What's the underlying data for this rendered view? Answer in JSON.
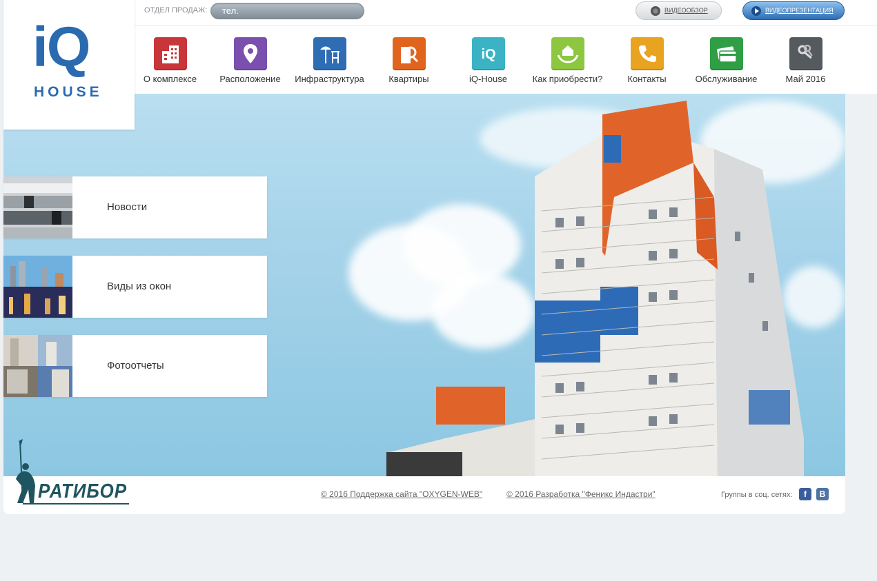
{
  "header": {
    "sales_label": "ОТДЕЛ ПРОДАЖ:",
    "phone_label": "тел.",
    "video_review": "ВИДЕООБЗОР",
    "video_presentation": "ВИДЕОПРЕЗЕНТАЦИЯ"
  },
  "logo": {
    "iq": "iQ",
    "house": "HOUSE"
  },
  "nav": [
    {
      "label": "О комплексе",
      "color": "#c8363a",
      "icon": "building-icon"
    },
    {
      "label": "Расположение",
      "color": "#7b4fae",
      "icon": "map-pin-icon"
    },
    {
      "label": "Инфраструктура",
      "color": "#2e6db4",
      "icon": "playground-icon"
    },
    {
      "label": "Квартиры",
      "color": "#e0641e",
      "icon": "search-building-icon"
    },
    {
      "label": "iQ-House",
      "color": "#3bb3c5",
      "icon": "iq-logo-icon"
    },
    {
      "label": "Как приобрести?",
      "color": "#8dc63f",
      "icon": "house-hands-icon"
    },
    {
      "label": "Контакты",
      "color": "#e8a321",
      "icon": "phone-icon"
    },
    {
      "label": "Обслуживание",
      "color": "#2f9e45",
      "icon": "card-icon"
    },
    {
      "label": "Май 2016",
      "color": "#555a5f",
      "icon": "keys-icon"
    }
  ],
  "cards": [
    {
      "label": "Новости",
      "thumb": "pipes-thumbnail"
    },
    {
      "label": "Виды из окон",
      "thumb": "city-view-thumbnail"
    },
    {
      "label": "Фотоотчеты",
      "thumb": "construction-photo-thumbnail"
    }
  ],
  "footer": {
    "brand": "РАТИБОР",
    "support_link": "© 2016 Поддержка сайта \"OXYGEN-WEB\"",
    "dev_link": "© 2016 Разработка \"Феникс Индастри\"",
    "social_label": "Группы в соц. сетях:",
    "facebook": "f",
    "vk": "B"
  }
}
